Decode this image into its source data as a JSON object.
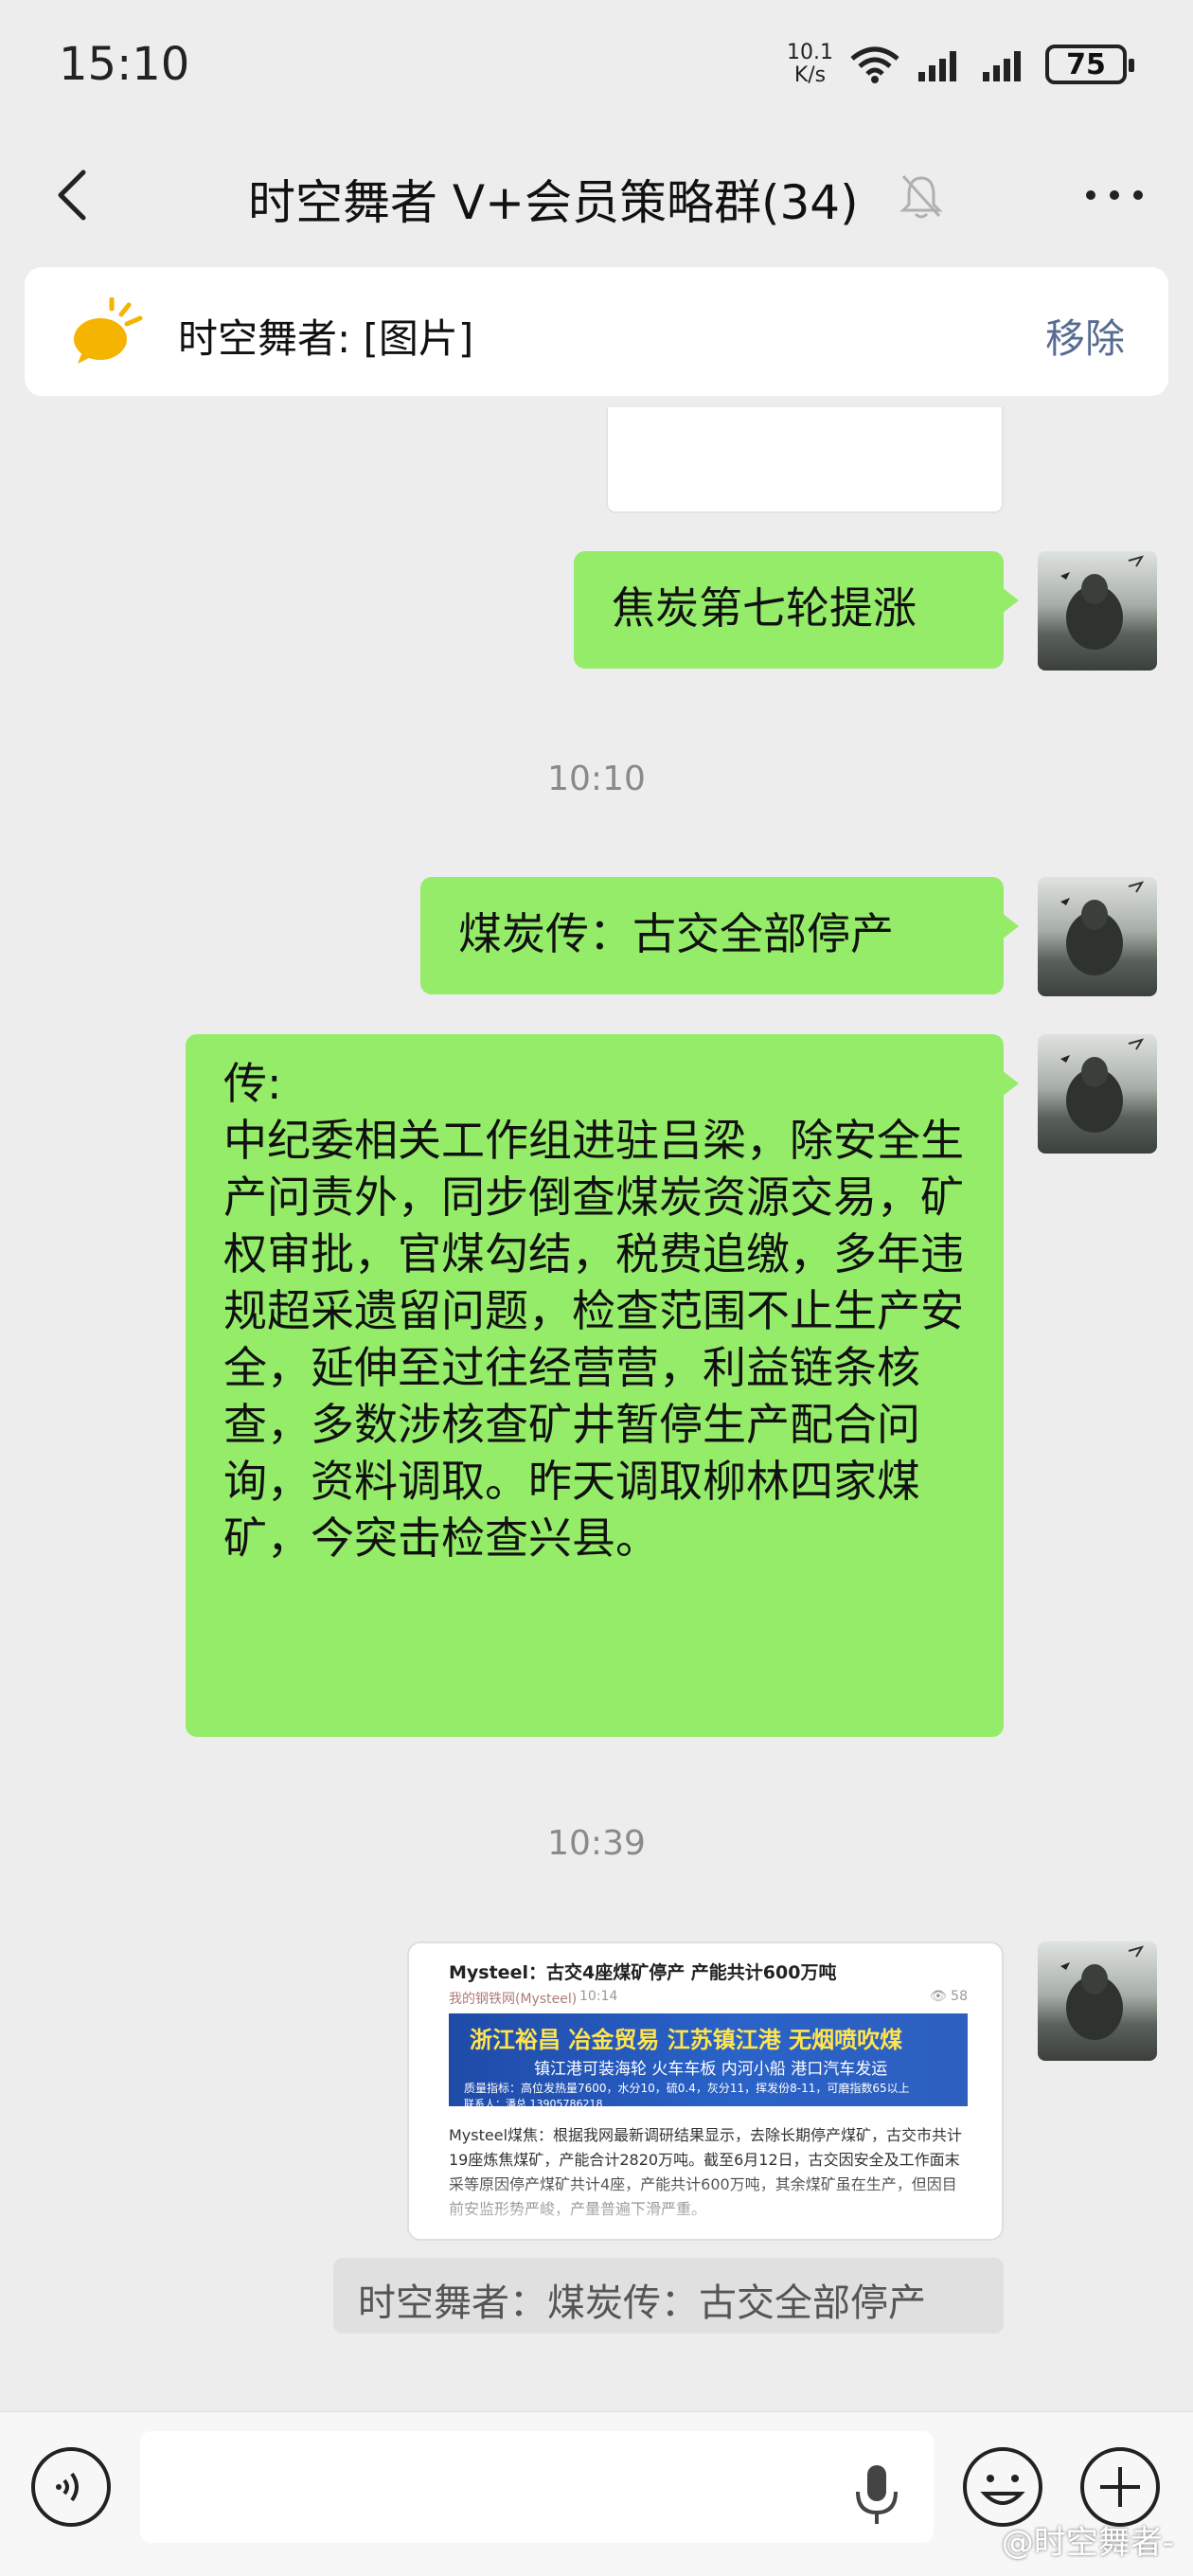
{
  "status_bar": {
    "time": "15:10",
    "net_speed_value": "10.1",
    "net_speed_unit": "K/s",
    "battery": "75"
  },
  "header": {
    "title": "时空舞者 V+会员策略群(34)"
  },
  "pinned": {
    "text": "时空舞者: [图片]",
    "remove_label": "移除"
  },
  "messages": {
    "msg1": "焦炭第七轮提涨",
    "time1": "10:10",
    "msg2": "煤炭传：古交全部停产",
    "msg3": "传:\n中纪委相关工作组进驻吕梁，除安全生产问责外，同步倒查煤炭资源交易，矿权审批，官煤勾结，税费追缴，多年违规超采遗留问题，检查范围不止生产安全，延伸至过往经营营，利益链条核查，多数涉核查矿井暂停生产配合问询，资料调取。昨天调取柳林四家煤矿，今突击检查兴县。",
    "time2": "10:39"
  },
  "link_card": {
    "title": "Mysteel：古交4座煤矿停产 产能共计600万吨",
    "source": "我的钢铁网(Mysteel)",
    "time": "10:14",
    "views": "58",
    "banner_line1": "浙江裕昌  冶金贸易  江苏镇江港  无烟喷吹煤",
    "banner_line2": "镇江港可装海轮  火车车板  内河小船  港口汽车发运",
    "banner_line3": "质量指标：高位发热量7600，水分10，硫0.4，灰分11，挥发份8-11，可磨指数65以上",
    "banner_line4": "联系人：潘总  13905786218",
    "body": "Mysteel煤焦：根据我网最新调研结果显示，去除长期停产煤矿，古交市共计19座炼焦煤矿，产能合计2820万吨。截至6月12日，古交因安全及工作面末采等原因停产煤矿共计4座，产能共计600万吨，其余煤矿虽在生产，但因目前安监形势严峻，产量普遍下滑严重。"
  },
  "quote": {
    "text": "时空舞者：煤炭传：古交全部停产"
  },
  "input": {
    "value": ""
  },
  "watermark": "@时空舞者-",
  "colors": {
    "bubble_green": "#95ec69",
    "background": "#ededed",
    "link_blue": "#586b91"
  },
  "icons": [
    "back-icon",
    "mute-bell-icon",
    "more-icon",
    "pin-megaphone-icon",
    "voice-icon",
    "mic-icon",
    "emoji-icon",
    "plus-icon"
  ]
}
